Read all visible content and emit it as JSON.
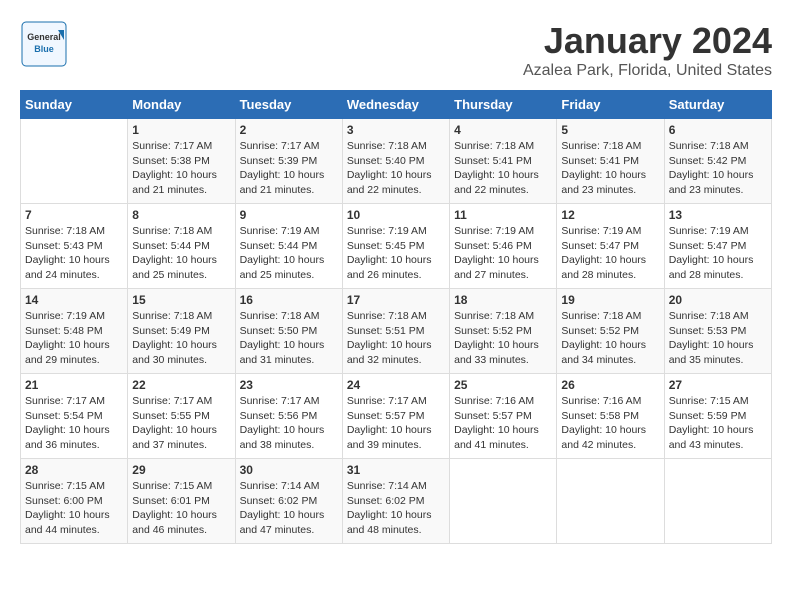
{
  "logo": {
    "general": "General",
    "blue": "Blue"
  },
  "header": {
    "month": "January 2024",
    "location": "Azalea Park, Florida, United States"
  },
  "weekdays": [
    "Sunday",
    "Monday",
    "Tuesday",
    "Wednesday",
    "Thursday",
    "Friday",
    "Saturday"
  ],
  "weeks": [
    [
      {
        "day": "",
        "info": ""
      },
      {
        "day": "1",
        "info": "Sunrise: 7:17 AM\nSunset: 5:38 PM\nDaylight: 10 hours\nand 21 minutes."
      },
      {
        "day": "2",
        "info": "Sunrise: 7:17 AM\nSunset: 5:39 PM\nDaylight: 10 hours\nand 21 minutes."
      },
      {
        "day": "3",
        "info": "Sunrise: 7:18 AM\nSunset: 5:40 PM\nDaylight: 10 hours\nand 22 minutes."
      },
      {
        "day": "4",
        "info": "Sunrise: 7:18 AM\nSunset: 5:41 PM\nDaylight: 10 hours\nand 22 minutes."
      },
      {
        "day": "5",
        "info": "Sunrise: 7:18 AM\nSunset: 5:41 PM\nDaylight: 10 hours\nand 23 minutes."
      },
      {
        "day": "6",
        "info": "Sunrise: 7:18 AM\nSunset: 5:42 PM\nDaylight: 10 hours\nand 23 minutes."
      }
    ],
    [
      {
        "day": "7",
        "info": "Sunrise: 7:18 AM\nSunset: 5:43 PM\nDaylight: 10 hours\nand 24 minutes."
      },
      {
        "day": "8",
        "info": "Sunrise: 7:18 AM\nSunset: 5:44 PM\nDaylight: 10 hours\nand 25 minutes."
      },
      {
        "day": "9",
        "info": "Sunrise: 7:19 AM\nSunset: 5:44 PM\nDaylight: 10 hours\nand 25 minutes."
      },
      {
        "day": "10",
        "info": "Sunrise: 7:19 AM\nSunset: 5:45 PM\nDaylight: 10 hours\nand 26 minutes."
      },
      {
        "day": "11",
        "info": "Sunrise: 7:19 AM\nSunset: 5:46 PM\nDaylight: 10 hours\nand 27 minutes."
      },
      {
        "day": "12",
        "info": "Sunrise: 7:19 AM\nSunset: 5:47 PM\nDaylight: 10 hours\nand 28 minutes."
      },
      {
        "day": "13",
        "info": "Sunrise: 7:19 AM\nSunset: 5:47 PM\nDaylight: 10 hours\nand 28 minutes."
      }
    ],
    [
      {
        "day": "14",
        "info": "Sunrise: 7:19 AM\nSunset: 5:48 PM\nDaylight: 10 hours\nand 29 minutes."
      },
      {
        "day": "15",
        "info": "Sunrise: 7:18 AM\nSunset: 5:49 PM\nDaylight: 10 hours\nand 30 minutes."
      },
      {
        "day": "16",
        "info": "Sunrise: 7:18 AM\nSunset: 5:50 PM\nDaylight: 10 hours\nand 31 minutes."
      },
      {
        "day": "17",
        "info": "Sunrise: 7:18 AM\nSunset: 5:51 PM\nDaylight: 10 hours\nand 32 minutes."
      },
      {
        "day": "18",
        "info": "Sunrise: 7:18 AM\nSunset: 5:52 PM\nDaylight: 10 hours\nand 33 minutes."
      },
      {
        "day": "19",
        "info": "Sunrise: 7:18 AM\nSunset: 5:52 PM\nDaylight: 10 hours\nand 34 minutes."
      },
      {
        "day": "20",
        "info": "Sunrise: 7:18 AM\nSunset: 5:53 PM\nDaylight: 10 hours\nand 35 minutes."
      }
    ],
    [
      {
        "day": "21",
        "info": "Sunrise: 7:17 AM\nSunset: 5:54 PM\nDaylight: 10 hours\nand 36 minutes."
      },
      {
        "day": "22",
        "info": "Sunrise: 7:17 AM\nSunset: 5:55 PM\nDaylight: 10 hours\nand 37 minutes."
      },
      {
        "day": "23",
        "info": "Sunrise: 7:17 AM\nSunset: 5:56 PM\nDaylight: 10 hours\nand 38 minutes."
      },
      {
        "day": "24",
        "info": "Sunrise: 7:17 AM\nSunset: 5:57 PM\nDaylight: 10 hours\nand 39 minutes."
      },
      {
        "day": "25",
        "info": "Sunrise: 7:16 AM\nSunset: 5:57 PM\nDaylight: 10 hours\nand 41 minutes."
      },
      {
        "day": "26",
        "info": "Sunrise: 7:16 AM\nSunset: 5:58 PM\nDaylight: 10 hours\nand 42 minutes."
      },
      {
        "day": "27",
        "info": "Sunrise: 7:15 AM\nSunset: 5:59 PM\nDaylight: 10 hours\nand 43 minutes."
      }
    ],
    [
      {
        "day": "28",
        "info": "Sunrise: 7:15 AM\nSunset: 6:00 PM\nDaylight: 10 hours\nand 44 minutes."
      },
      {
        "day": "29",
        "info": "Sunrise: 7:15 AM\nSunset: 6:01 PM\nDaylight: 10 hours\nand 46 minutes."
      },
      {
        "day": "30",
        "info": "Sunrise: 7:14 AM\nSunset: 6:02 PM\nDaylight: 10 hours\nand 47 minutes."
      },
      {
        "day": "31",
        "info": "Sunrise: 7:14 AM\nSunset: 6:02 PM\nDaylight: 10 hours\nand 48 minutes."
      },
      {
        "day": "",
        "info": ""
      },
      {
        "day": "",
        "info": ""
      },
      {
        "day": "",
        "info": ""
      }
    ]
  ]
}
